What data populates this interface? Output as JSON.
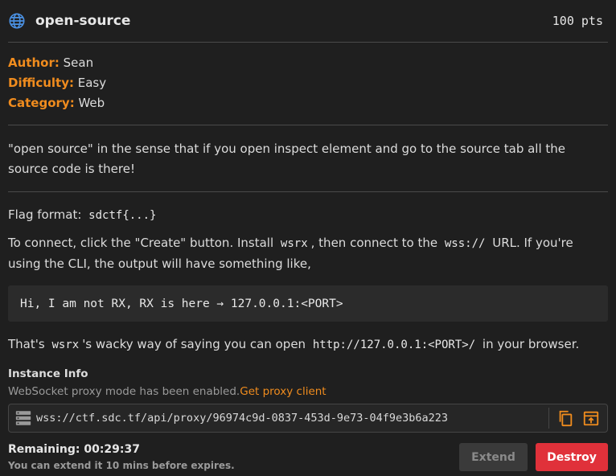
{
  "challenge": {
    "icon": "globe-icon",
    "title": "open-source",
    "points": "100 pts"
  },
  "meta": [
    {
      "key": "Author:",
      "value": "Sean"
    },
    {
      "key": "Difficulty:",
      "value": "Easy"
    },
    {
      "key": "Category:",
      "value": "Web"
    }
  ],
  "description": "\"open source\" in the sense that if you open inspect element and go to the source tab all the source code is there!",
  "flag": {
    "label": "Flag format:",
    "format": "sdctf{...}"
  },
  "connect": {
    "pre": "To connect, click the \"Create\" button. Install",
    "tool": "wsrx",
    "mid": ", then connect to the",
    "scheme": "wss://",
    "post": "URL. If you're using the CLI, the output will have something like,"
  },
  "code_sample": "Hi, I am not RX, RX is here → 127.0.0.1:<PORT>",
  "wacky": {
    "pre": "That's",
    "tool": "wsrx",
    "mid": "'s wacky way of saying you can open",
    "url": "http://127.0.0.1:<PORT>/",
    "post": "in your browser."
  },
  "instance": {
    "title": "Instance Info",
    "notice": "WebSocket proxy mode has been enabled.",
    "proxy_link": "Get proxy client",
    "url": "wss://ctf.sdc.tf/api/proxy/96974c9d-0837-453d-9e73-04f9e3b6a223",
    "remaining": "Remaining: 00:29:37",
    "extend_note": "You can extend it 10 mins before expires.",
    "extend_label": "Extend",
    "destroy_label": "Destroy"
  },
  "colors": {
    "accent": "#f08c1e",
    "globe": "#4a90e2",
    "destroy": "#e0313a",
    "background": "#1f1f1f"
  }
}
